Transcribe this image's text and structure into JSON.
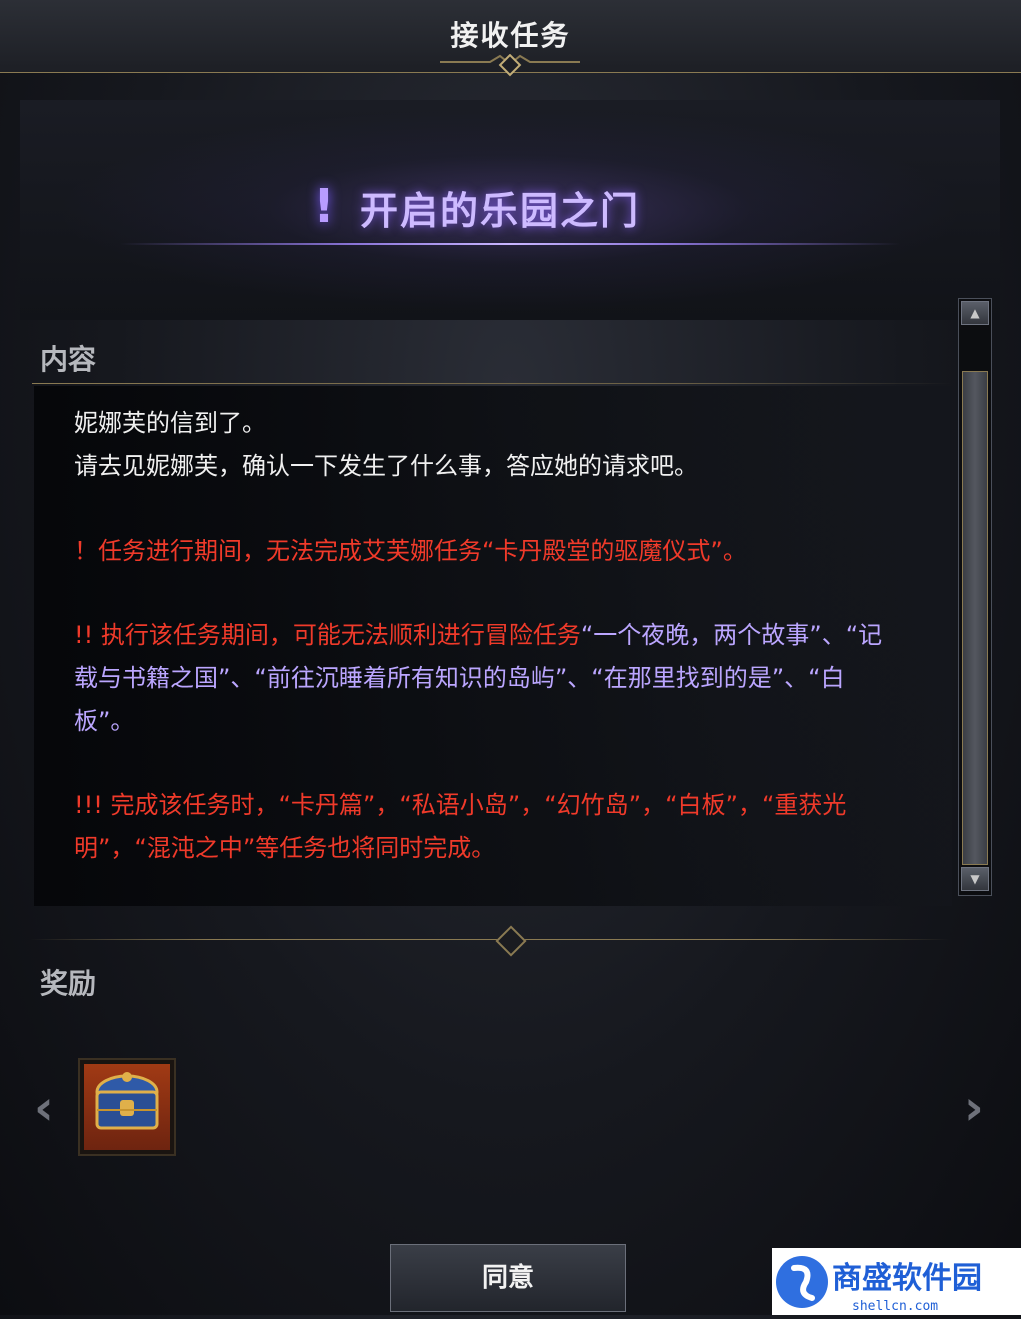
{
  "window": {
    "title": "接收任务"
  },
  "quest": {
    "marker": "!",
    "title": "开启的乐园之门"
  },
  "sections": {
    "content_label": "内容",
    "reward_label": "奖励"
  },
  "content": {
    "line1": "妮娜芙的信到了。",
    "line2": "请去见妮娜芙，确认一下发生了什么事，答应她的请求吧。",
    "warning1": "！任务进行期间，无法完成艾芙娜任务“卡丹殿堂的驱魔仪式”。",
    "warning2_prefix": "!! 执行该任务期间，可能无法顺利进行冒险任务",
    "warning2_quests": "“一个夜晚，两个故事”、“记载与书籍之国”、“前往沉睡着所有知识的岛屿”、“在那里找到的是”、“白板”。",
    "warning3": "!!! 完成该任务时，“卡丹篇”，“私语小岛”，“幻竹岛”，“白板”，“重获光明”，“混沌之中”等任务也将同时完成。"
  },
  "scrollbar": {
    "up_icon": "▲",
    "down_icon": "▼",
    "position": 0.0
  },
  "rewards": {
    "prev_icon": "‹",
    "next_icon": "›",
    "items": [
      {
        "icon": "treasure-chest-icon"
      }
    ]
  },
  "actions": {
    "agree_label": "同意"
  },
  "colors": {
    "warning": "#f03a2a",
    "quest_names": "#bba6ff",
    "quest_title": "#cdbaff",
    "accent_gold": "#8a7a52"
  },
  "watermark": {
    "text": "商盛软件园",
    "subtext": "shellcn.com"
  }
}
